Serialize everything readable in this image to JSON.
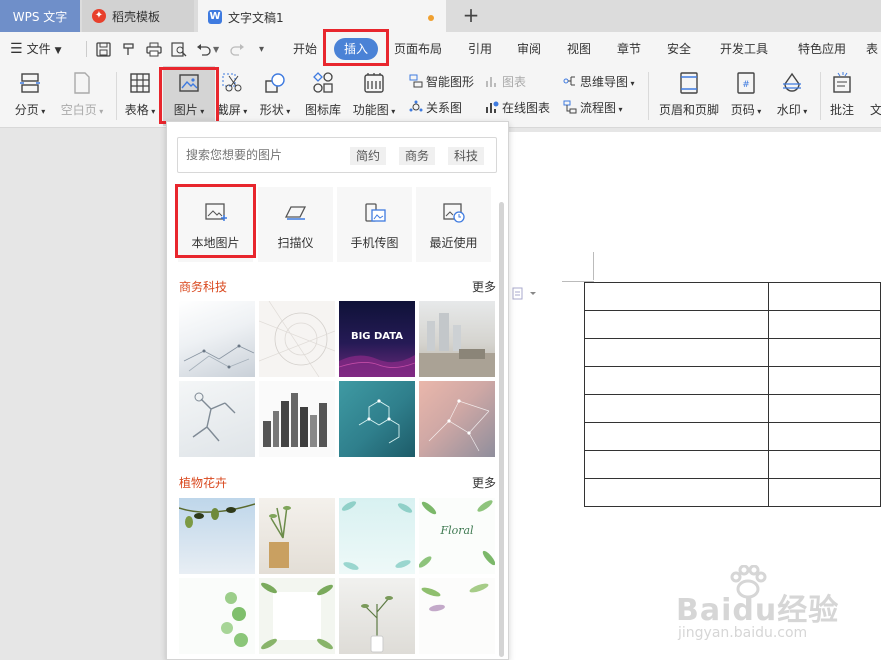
{
  "titlebar": {
    "tabs": [
      {
        "label": "WPS 文字"
      },
      {
        "label": "稻壳模板"
      },
      {
        "label": "文字文稿1"
      }
    ],
    "new_tab": "+"
  },
  "menubar": {
    "file_label": "文件",
    "items": [
      "开始",
      "插入",
      "页面布局",
      "引用",
      "审阅",
      "视图",
      "章节",
      "安全",
      "开发工具",
      "特色应用",
      "表"
    ],
    "active": "插入"
  },
  "ribbon": {
    "page_break": "分页",
    "blank_page": "空白页",
    "table": "表格",
    "picture": "图片",
    "screenshot": "截屏",
    "shapes": "形状",
    "icon_library": "图标库",
    "function_chart": "功能图",
    "smart_art": "智能图形",
    "chart": "图表",
    "mind_map": "思维导图",
    "relation_chart": "关系图",
    "online_chart": "在线图表",
    "flowchart": "流程图",
    "header_footer": "页眉和页脚",
    "page_number": "页码",
    "watermark": "水印",
    "comment": "批注",
    "text_cut": "文"
  },
  "panel": {
    "search_placeholder": "搜索您想要的图片",
    "search_tags": [
      "简约",
      "商务",
      "科技"
    ],
    "sources": [
      {
        "label": "本地图片",
        "icon": "local-picture-icon"
      },
      {
        "label": "扫描仪",
        "icon": "scanner-icon"
      },
      {
        "label": "手机传图",
        "icon": "phone-transfer-icon"
      },
      {
        "label": "最近使用",
        "icon": "recent-icon"
      }
    ],
    "sections": [
      {
        "title": "商务科技",
        "more": "更多",
        "thumb_texts": [
          "BIG DATA"
        ]
      },
      {
        "title": "植物花卉",
        "more": "更多",
        "thumb_texts": [
          "Floral"
        ]
      }
    ]
  },
  "watermark_text": "Baidu经验",
  "watermark_url": "jingyan.baidu.com",
  "colors": {
    "accent": "#4a82d6",
    "highlight_box": "#e8262d",
    "section_title": "#d9481e",
    "wps_tab": "#6f8fc9"
  }
}
